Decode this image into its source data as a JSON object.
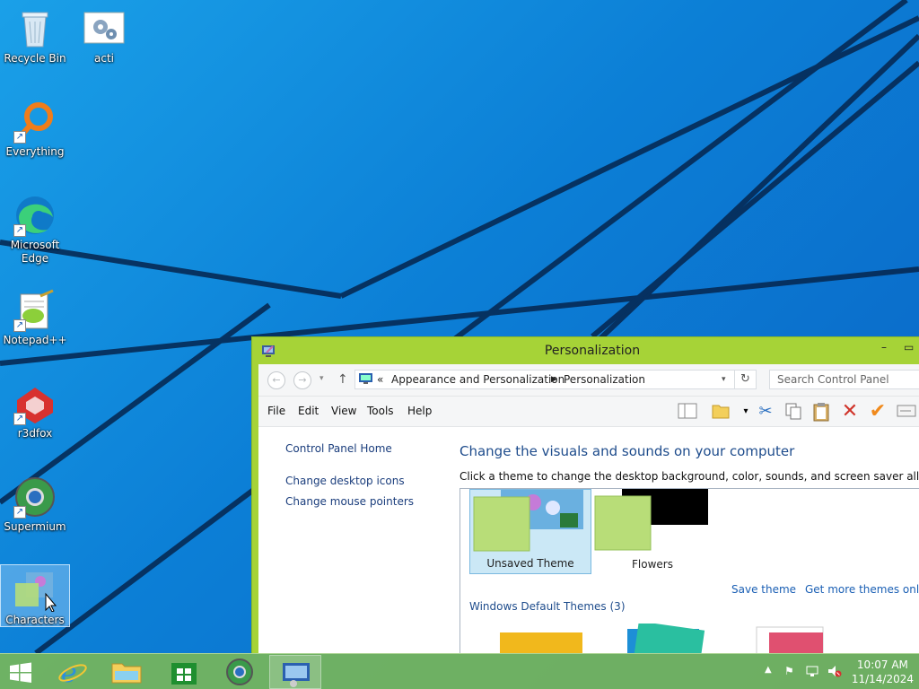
{
  "desktop": {
    "icons": [
      {
        "label": "Recycle Bin"
      },
      {
        "label": "acti"
      },
      {
        "label": "Everything"
      },
      {
        "label": "Microsoft Edge"
      },
      {
        "label": "Notepad++"
      },
      {
        "label": "r3dfox"
      },
      {
        "label": "Supermium"
      },
      {
        "label": "Characters"
      }
    ]
  },
  "window": {
    "title": "Personalization",
    "address": {
      "separator": "«",
      "crumbs": [
        "Appearance and Personalization",
        "Personalization"
      ]
    },
    "search_placeholder": "Search Control Panel",
    "menu": [
      "File",
      "Edit",
      "View",
      "Tools",
      "Help"
    ],
    "left_links": [
      "Control Panel Home",
      "Change desktop icons",
      "Change mouse pointers"
    ],
    "heading": "Change the visuals and sounds on your computer",
    "subtext": "Click a theme to change the desktop background, color, sounds, and screen saver all at once.",
    "themes": [
      {
        "label": "Unsaved Theme",
        "selected": true
      },
      {
        "label": "Flowers",
        "selected": false
      }
    ],
    "save_theme": "Save theme",
    "get_more": "Get more themes online",
    "defaults_title": "Windows Default Themes (3)"
  },
  "taskbar": {
    "time": "10:07 AM",
    "date": "11/14/2024"
  },
  "colors": {
    "window_frame": "#a6d337",
    "taskbar": "#7cb854",
    "desktop": "#0c7fd6",
    "link": "#1a5fb4"
  }
}
